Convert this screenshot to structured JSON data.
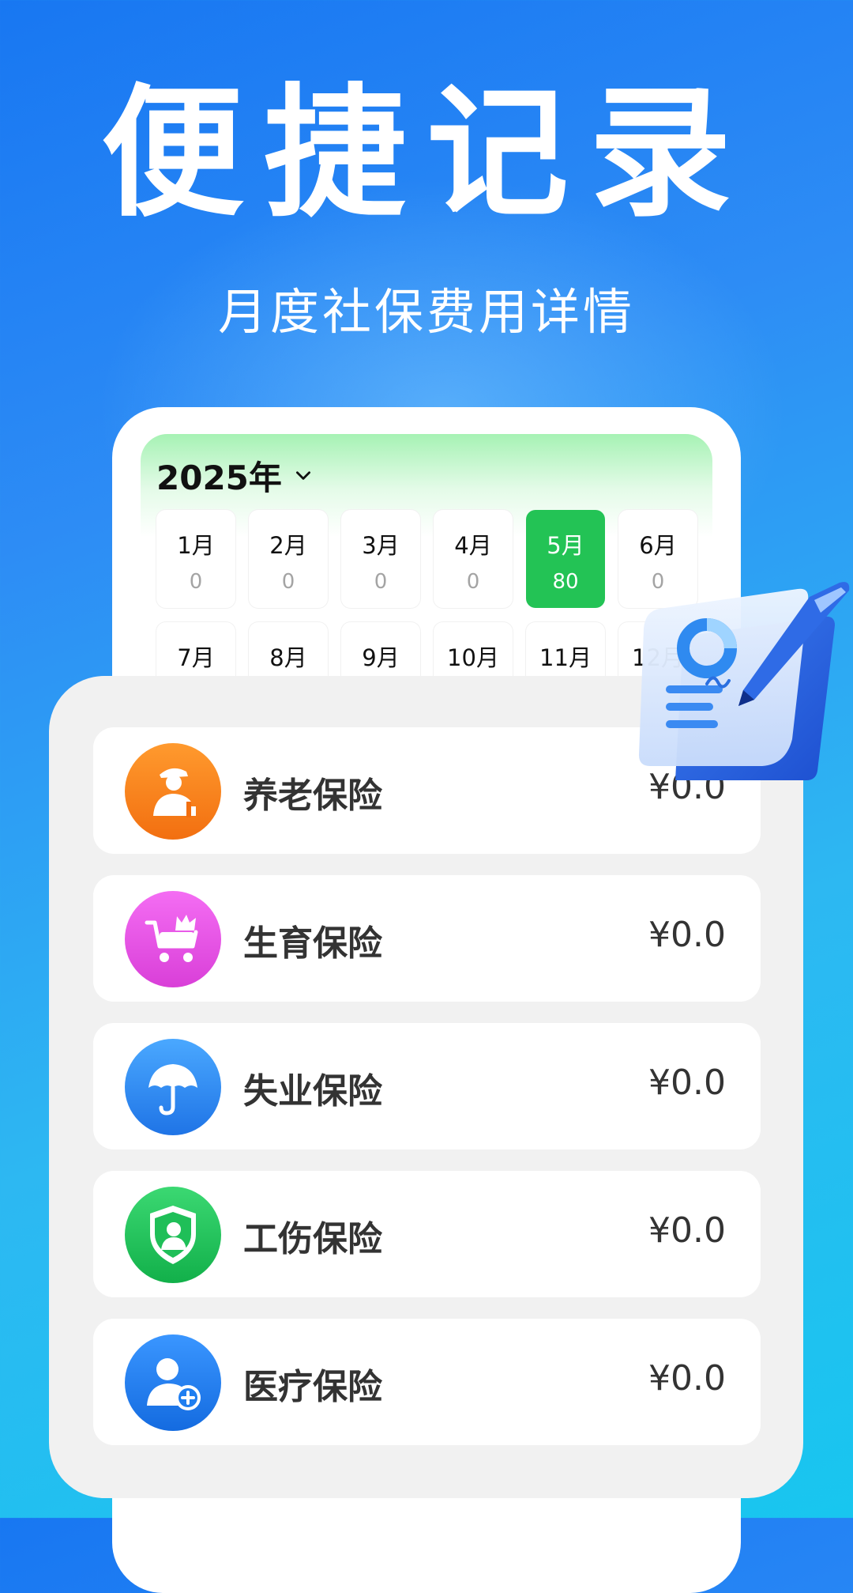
{
  "hero": {
    "title": "便捷记录",
    "subtitle": "月度社保费用详情"
  },
  "calendar": {
    "year_label": "2025年",
    "months": [
      {
        "label": "1月",
        "value": "0"
      },
      {
        "label": "2月",
        "value": "0"
      },
      {
        "label": "3月",
        "value": "0"
      },
      {
        "label": "4月",
        "value": "0"
      },
      {
        "label": "5月",
        "value": "80",
        "selected": true
      },
      {
        "label": "6月",
        "value": "0"
      },
      {
        "label": "7月"
      },
      {
        "label": "8月"
      },
      {
        "label": "9月"
      },
      {
        "label": "10月"
      },
      {
        "label": "11月"
      },
      {
        "label": "12月"
      }
    ]
  },
  "insurance": [
    {
      "name": "养老保险",
      "amount": "¥0.0",
      "icon": "elderly-person-icon",
      "color": "#f7821c"
    },
    {
      "name": "生育保险",
      "amount": "¥0.0",
      "icon": "baby-stroller-icon",
      "color": "#e84fe6"
    },
    {
      "name": "失业保险",
      "amount": "¥0.0",
      "icon": "umbrella-icon",
      "color": "#2f8af0"
    },
    {
      "name": "工伤保险",
      "amount": "¥0.0",
      "icon": "shield-person-icon",
      "color": "#22c25a"
    },
    {
      "name": "医疗保险",
      "amount": "¥0.0",
      "icon": "medical-person-icon",
      "color": "#1f7ef0"
    }
  ],
  "colors": {
    "selected_month": "#23c355",
    "background_top": "#1877f2",
    "background_bottom": "#18c6ef"
  }
}
